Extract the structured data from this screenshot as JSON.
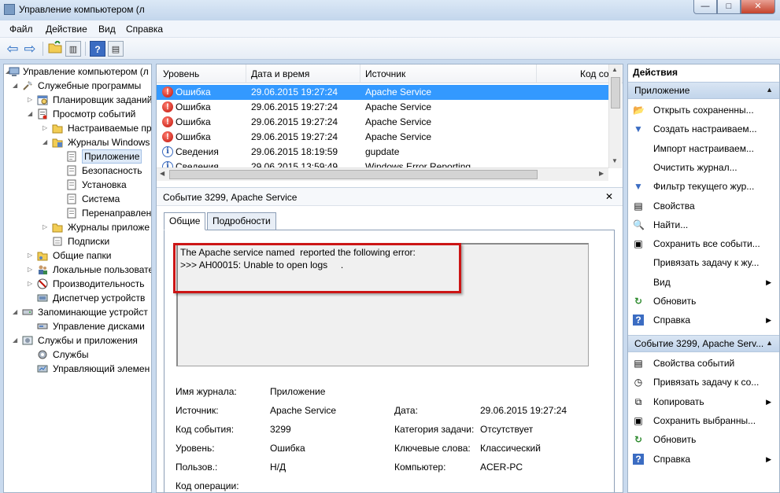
{
  "window": {
    "title": "Управление компьютером (л",
    "btn_min": "—",
    "btn_max": "□",
    "btn_close": "✕"
  },
  "menu": [
    "Файл",
    "Действие",
    "Вид",
    "Справка"
  ],
  "toolbar": {
    "back": "⇦",
    "forward": "⇨",
    "help": "?"
  },
  "tree": [
    {
      "label": "Управление компьютером (л",
      "icon": "computer-management-icon"
    },
    {
      "label": "Служебные программы",
      "icon": "tools-icon"
    },
    {
      "label": "Планировщик заданий",
      "icon": "task-scheduler-icon"
    },
    {
      "label": "Просмотр событий",
      "icon": "event-viewer-icon"
    },
    {
      "label": "Настраиваемые пр",
      "icon": "folder-icon"
    },
    {
      "label": "Журналы Windows",
      "icon": "folder-icon"
    },
    {
      "label": "Приложение",
      "icon": "log-icon"
    },
    {
      "label": "Безопасность",
      "icon": "log-icon"
    },
    {
      "label": "Установка",
      "icon": "log-icon"
    },
    {
      "label": "Система",
      "icon": "log-icon"
    },
    {
      "label": "Перенаправлен",
      "icon": "log-icon"
    },
    {
      "label": "Журналы приложе",
      "icon": "folder-icon"
    },
    {
      "label": "Подписки",
      "icon": "subscriptions-icon"
    },
    {
      "label": "Общие папки",
      "icon": "shared-folders-icon"
    },
    {
      "label": "Локальные пользовате",
      "icon": "users-icon"
    },
    {
      "label": "Производительность",
      "icon": "performance-icon"
    },
    {
      "label": "Диспетчер устройств",
      "icon": "device-manager-icon"
    },
    {
      "label": "Запоминающие устройст",
      "icon": "storage-icon"
    },
    {
      "label": "Управление дисками",
      "icon": "disk-management-icon"
    },
    {
      "label": "Службы и приложения",
      "icon": "services-apps-icon"
    },
    {
      "label": "Службы",
      "icon": "services-icon"
    },
    {
      "label": "Управляющий элемен",
      "icon": "wmi-control-icon"
    }
  ],
  "events": {
    "columns": [
      "Уровень",
      "Дата и время",
      "Источник",
      "Код со"
    ],
    "rows": [
      {
        "level": "Ошибка",
        "date": "29.06.2015 19:27:24",
        "source": "Apache Service",
        "type": "error",
        "icon_glyph": "!"
      },
      {
        "level": "Ошибка",
        "date": "29.06.2015 19:27:24",
        "source": "Apache Service",
        "type": "error",
        "icon_glyph": "!"
      },
      {
        "level": "Ошибка",
        "date": "29.06.2015 19:27:24",
        "source": "Apache Service",
        "type": "error",
        "icon_glyph": "!"
      },
      {
        "level": "Ошибка",
        "date": "29.06.2015 19:27:24",
        "source": "Apache Service",
        "type": "error",
        "icon_glyph": "!"
      },
      {
        "level": "Сведения",
        "date": "29.06.2015 18:19:59",
        "source": "gupdate",
        "type": "info",
        "icon_glyph": "i"
      },
      {
        "level": "Сведения",
        "date": "29.06.2015 13:59:49",
        "source": "Windows Error Reporting",
        "type": "info",
        "icon_glyph": "i"
      }
    ]
  },
  "detail": {
    "title": "Событие 3299, Apache Service",
    "close": "✕",
    "tabs": [
      "Общие",
      "Подробности"
    ],
    "message_line1": "The Apache service named  reported the following error:",
    "message_line2": ">>> AH00015: Unable to open logs     .",
    "fields": {
      "log_name_label": "Имя журнала:",
      "log_name": "Приложение",
      "source_label": "Источник:",
      "source": "Apache Service",
      "date_label": "Дата:",
      "date": "29.06.2015 19:27:24",
      "event_id_label": "Код события:",
      "event_id": "3299",
      "task_label": "Категория задачи:",
      "task": "Отсутствует",
      "level_label": "Уровень:",
      "level": "Ошибка",
      "keywords_label": "Ключевые слова:",
      "keywords": "Классический",
      "user_label": "Пользов.:",
      "user": "Н/Д",
      "computer_label": "Компьютер:",
      "computer": "ACER-PC",
      "opcode_label": "Код операции:"
    }
  },
  "actions": {
    "title": "Действия",
    "section1": "Приложение",
    "items1": [
      {
        "label": "Открыть сохраненны...",
        "icon": "open-folder-icon",
        "glyph": "📂",
        "sub": false
      },
      {
        "label": "Создать настраиваем...",
        "icon": "filter-create-icon",
        "glyph": "▼",
        "sub": false
      },
      {
        "label": "Импорт настраиваем...",
        "icon": "blank-icon",
        "glyph": "",
        "sub": false
      },
      {
        "label": "Очистить журнал...",
        "icon": "blank-icon",
        "glyph": "",
        "sub": false
      },
      {
        "label": "Фильтр текущего жур...",
        "icon": "filter-icon",
        "glyph": "▼",
        "sub": false
      },
      {
        "label": "Свойства",
        "icon": "properties-icon",
        "glyph": "▤",
        "sub": false
      },
      {
        "label": "Найти...",
        "icon": "find-icon",
        "glyph": "🔍",
        "sub": false
      },
      {
        "label": "Сохранить все событи...",
        "icon": "save-icon",
        "glyph": "▣",
        "sub": false
      },
      {
        "label": "Привязать задачу к жу...",
        "icon": "blank-icon",
        "glyph": "",
        "sub": false
      },
      {
        "label": "Вид",
        "icon": "blank-icon",
        "glyph": "",
        "sub": true
      },
      {
        "label": "Обновить",
        "icon": "refresh-icon",
        "glyph": "↻",
        "sub": false
      },
      {
        "label": "Справка",
        "icon": "help-icon",
        "glyph": "?",
        "sub": true
      }
    ],
    "section2": "Событие 3299, Apache Serv...",
    "items2": [
      {
        "label": "Свойства событий",
        "icon": "event-properties-icon",
        "glyph": "▤",
        "sub": false
      },
      {
        "label": "Привязать задачу к со...",
        "icon": "attach-task-icon",
        "glyph": "◷",
        "sub": false
      },
      {
        "label": "Копировать",
        "icon": "copy-icon",
        "glyph": "⧉",
        "sub": true
      },
      {
        "label": "Сохранить выбранны...",
        "icon": "save-icon",
        "glyph": "▣",
        "sub": false
      },
      {
        "label": "Обновить",
        "icon": "refresh-icon",
        "glyph": "↻",
        "sub": false
      },
      {
        "label": "Справка",
        "icon": "help-icon",
        "glyph": "?",
        "sub": true
      }
    ]
  }
}
